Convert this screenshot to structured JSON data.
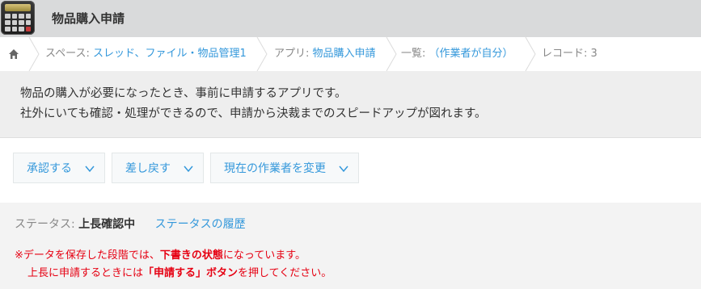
{
  "header": {
    "app_title": "物品購入申請"
  },
  "breadcrumb": {
    "space_label": "スペース:",
    "space_link": "スレッド、ファイル・物品管理1",
    "app_label": "アプリ:",
    "app_link": "物品購入申請",
    "list_label": "一覧:",
    "list_link": "（作業者が自分）",
    "record_label": "レコード: 3"
  },
  "description": {
    "line1": "物品の購入が必要になったとき、事前に申請するアプリです。",
    "line2": "社外にいても確認・処理ができるので、申請から決裁までのスピードアップが図れます。"
  },
  "actions": {
    "approve": "承認する",
    "send_back": "差し戻す",
    "change_assignee": "現在の作業者を変更"
  },
  "status": {
    "label": "ステータス:",
    "value": "上長確認中",
    "history_link": "ステータスの履歴"
  },
  "notice": {
    "line1_prefix": "※データを保存した段階では、",
    "line1_bold": "下書きの状態",
    "line1_suffix": "になっています。",
    "line2_prefix": "上長に申請するときには",
    "line2_bold": "「申請する」ボタン",
    "line2_suffix": "を押してください。"
  },
  "colors": {
    "accent": "#3498db",
    "warning": "#e60012"
  },
  "icons": [
    "calculator-icon",
    "home-icon",
    "chevron-down-icon"
  ]
}
